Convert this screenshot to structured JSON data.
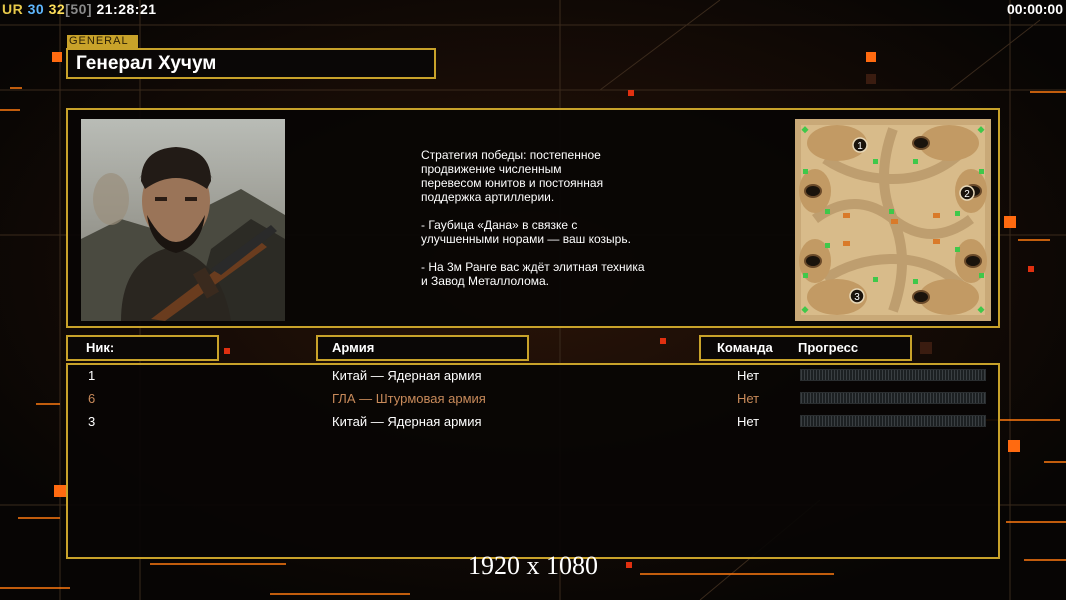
{
  "hud": {
    "ur_label": "UR",
    "fps": "30",
    "logic_fps": "32",
    "fps_limit": "[50]",
    "clock": "21:28:21",
    "timer": "00:00:00"
  },
  "general": {
    "tag": "GENERAL",
    "name": "Генерал Хучум"
  },
  "description": "Стратегия победы: постепенное\nпродвижение численным\nперевесом юнитов и постоянная\nподдержка артиллерии.\n\n- Гаубица «Дана» в связке с\nулучшенными норами — ваш козырь.\n\n- На 3м Ранге вас ждёт элитная техника\nи Завод Металлолома.",
  "minimap": {
    "start_positions": [
      "1",
      "2",
      "3"
    ]
  },
  "columns": {
    "nick": "Ник:",
    "army": "Армия",
    "team": "Команда",
    "progress": "Прогресс"
  },
  "players": [
    {
      "nick": "1",
      "army": "Китай — Ядерная армия",
      "team": "Нет",
      "progress": 0
    },
    {
      "nick": "6",
      "army": "ГЛА — Штурмовая армия",
      "team": "Нет",
      "progress": 0
    },
    {
      "nick": "3",
      "army": "Китай — Ядерная армия",
      "team": "Нет",
      "progress": 0
    }
  ],
  "resolution": "1920 x 1080",
  "colors": {
    "frame_gold": "#c8a22a",
    "accent_orange": "#ff7a10",
    "local_player": "#c88a5a"
  }
}
